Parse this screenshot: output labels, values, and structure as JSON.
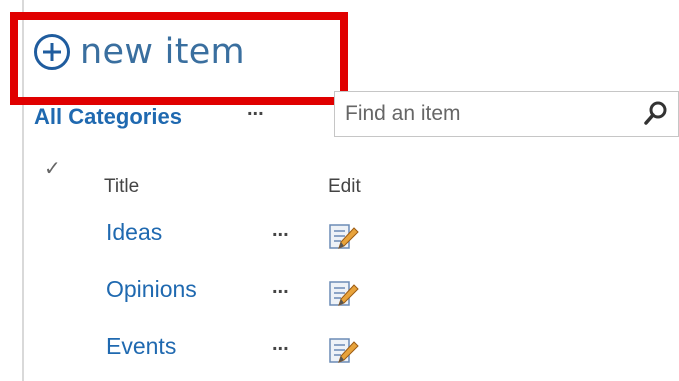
{
  "toolbar": {
    "new_item_label": "new item",
    "accent_color": "#1f69b0",
    "highlight_color": "#e00000"
  },
  "view": {
    "name": "All Categories",
    "more_label": "..."
  },
  "search": {
    "placeholder": "Find an item",
    "icon": "search-icon"
  },
  "list": {
    "checkmark": "✓",
    "columns": {
      "title": "Title",
      "edit": "Edit"
    },
    "items": [
      {
        "title": "Ideas",
        "menu": "...",
        "edit_icon": "edit-icon"
      },
      {
        "title": "Opinions",
        "menu": "...",
        "edit_icon": "edit-icon"
      },
      {
        "title": "Events",
        "menu": "...",
        "edit_icon": "edit-icon"
      }
    ]
  }
}
